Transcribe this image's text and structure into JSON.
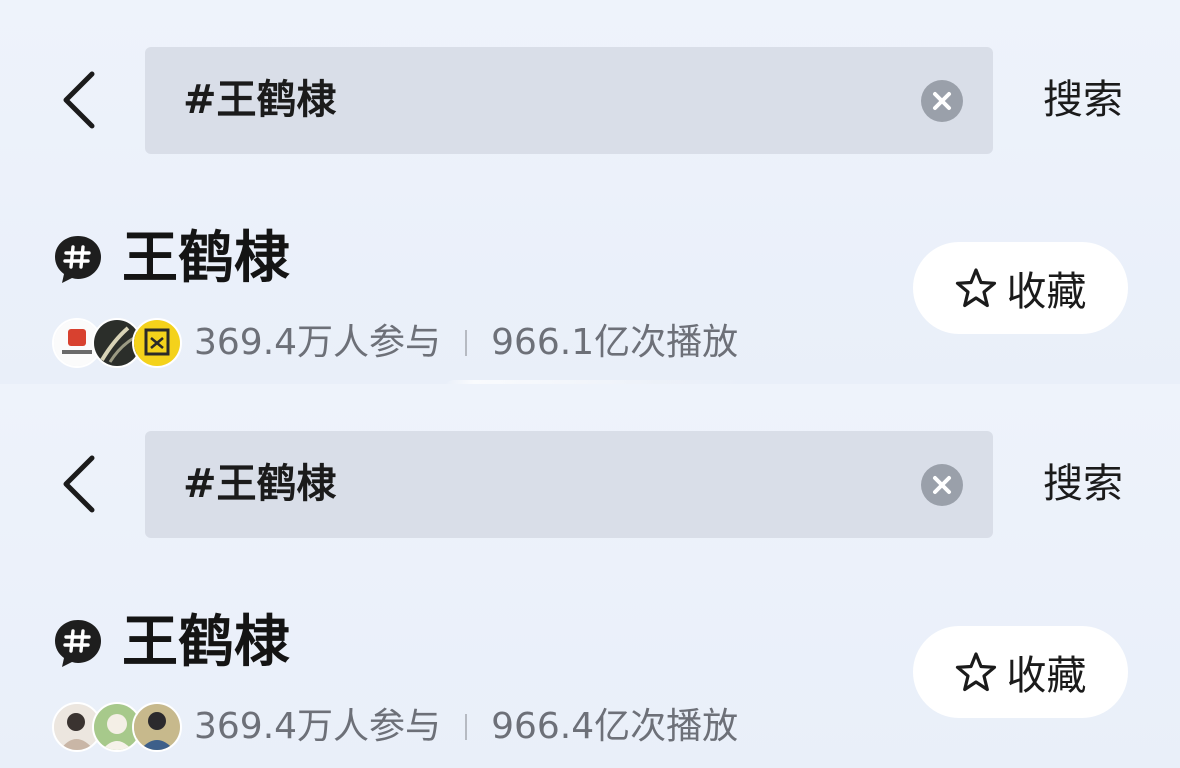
{
  "screens": [
    {
      "search": {
        "query": "#王鹤棣",
        "button_label": "搜索"
      },
      "topic": {
        "title": "王鹤棣",
        "collect_label": "收藏",
        "participants": "369.4万人参与",
        "views": "966.1亿次播放"
      }
    },
    {
      "search": {
        "query": "#王鹤棣",
        "button_label": "搜索"
      },
      "topic": {
        "title": "王鹤棣",
        "collect_label": "收藏",
        "participants": "369.4万人参与",
        "views": "966.4亿次播放"
      }
    }
  ],
  "icons": {
    "back": "chevron-left-icon",
    "clear": "clear-icon",
    "topic": "hashtag-bubble-icon",
    "collect": "star-outline-icon"
  },
  "colors": {
    "background": "#eaf0fa",
    "search_box": "#d9dee8",
    "stats_text": "#6d7078",
    "collect_button": "#ffffff"
  }
}
